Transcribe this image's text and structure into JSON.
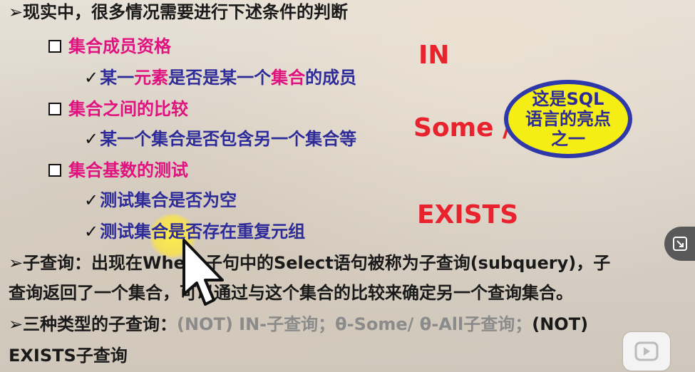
{
  "slide": {
    "line1": {
      "bullet": "➢",
      "text": "现实中，很多情况需要进行下述条件的判断"
    },
    "item1": {
      "label": "集合成员资格"
    },
    "item1_sub": {
      "p1": "某一",
      "p2": "元素",
      "p3": "是否是某一个",
      "p4": "集合",
      "p5": "的成员"
    },
    "item2": {
      "label": "集合之间的比较"
    },
    "item2_sub": {
      "text": "某一个集合是否包含另一个集合等"
    },
    "item3": {
      "label": "集合基数的测试"
    },
    "item3_sub1": {
      "text": "测试集合是否为空"
    },
    "item3_sub2": {
      "text": "测试集合是否存在重复元组"
    },
    "check": "✓",
    "tag_in": "IN",
    "tag_some_all": "Some / All",
    "tag_exists": "EXISTS",
    "oval_note": "这是SQL语言的亮点之一",
    "subquery": {
      "bullet": "➢",
      "line1": "子查询：出现在Where子句中的Select语句被称为子查询(subquery)，子",
      "line2": "查询返回了一个集合，可以通过与这个集合的比较来确定另一个查询集合。"
    },
    "types": {
      "bullet": "➢",
      "lead": "三种类型的子查询：",
      "gray1": "(NOT) IN-子查询；θ-Some/ θ-All子查询；",
      "tail1": "(NOT)",
      "line2": "EXISTS子查询"
    }
  },
  "colors": {
    "pink": "#e0127f",
    "blue": "#2d2b9a",
    "red": "#e8232e",
    "gray": "#8b8b8b",
    "oval_fill": "#f4ee15",
    "oval_border": "#2f38a8"
  },
  "icons": [
    "square-bullet-icon",
    "checkmark-icon",
    "arrow-bullet-icon",
    "mouse-cursor-icon",
    "expand-icon",
    "play-icon"
  ]
}
